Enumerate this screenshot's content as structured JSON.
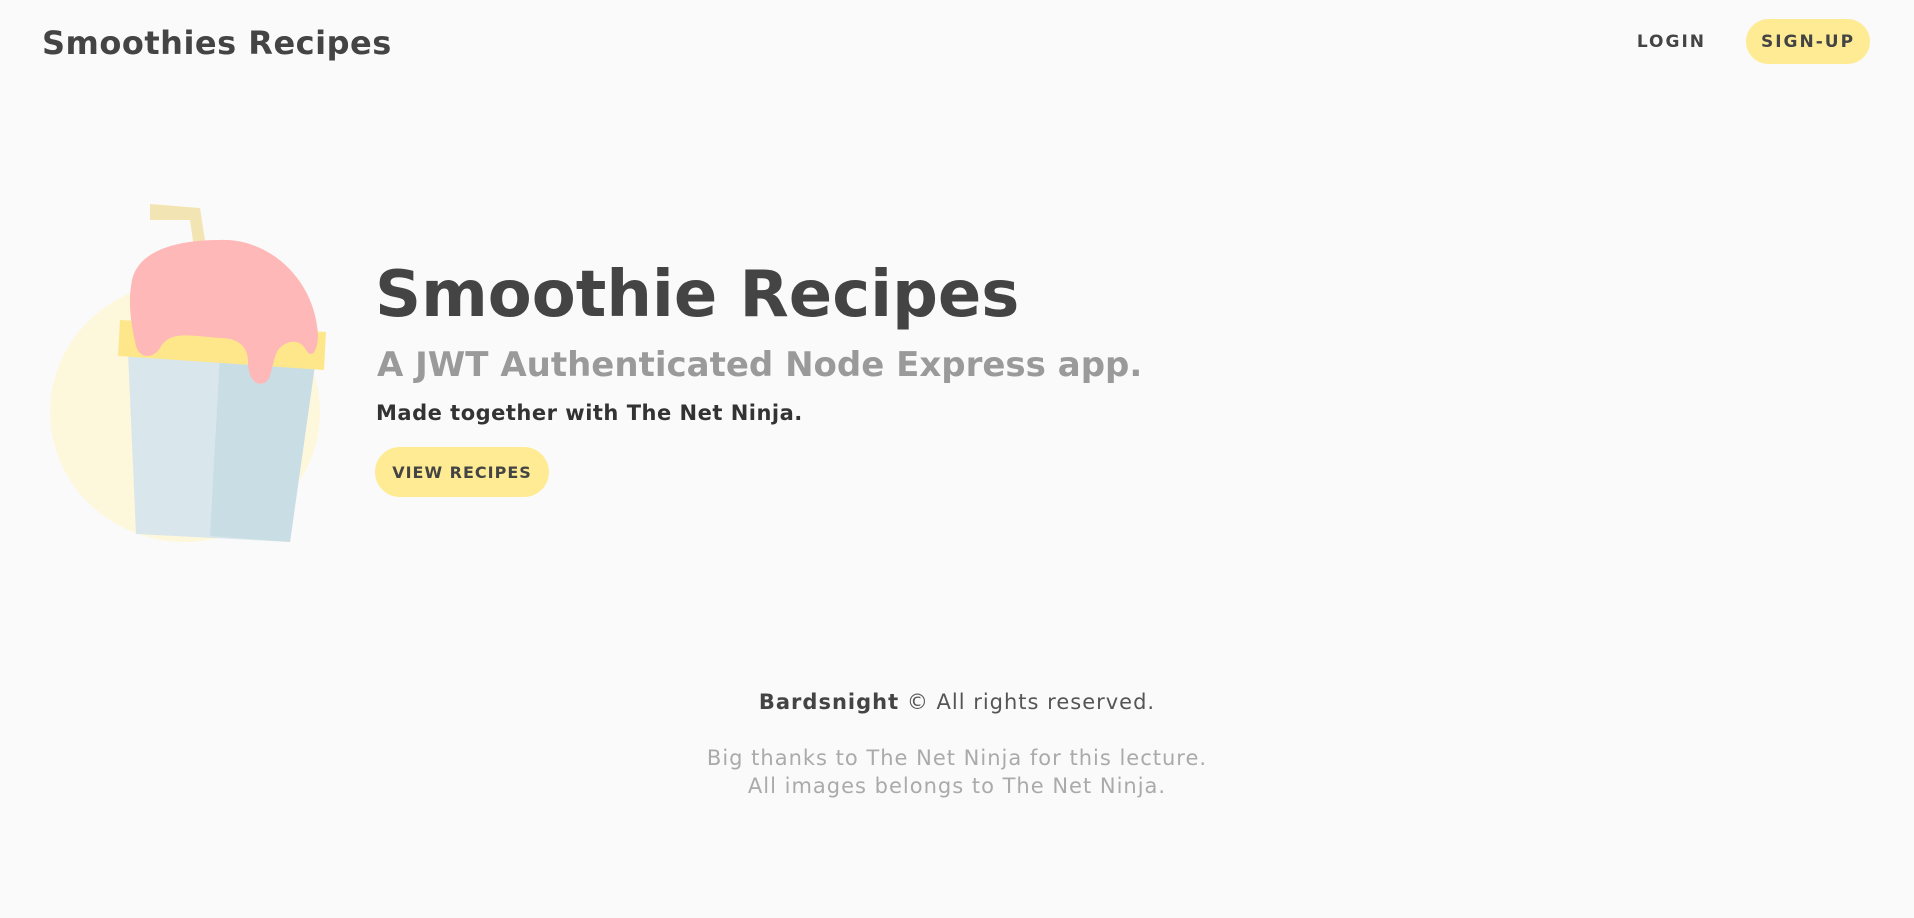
{
  "navbar": {
    "brand": "Smoothies Recipes",
    "login_label": "LOGIN",
    "signup_label": "SIGN-UP"
  },
  "hero": {
    "title": "Smoothie Recipes",
    "subtitle": "A JWT Authenticated Node Express app.",
    "tagline": "Made together with The Net Ninja.",
    "button_label": "VIEW RECIPES"
  },
  "footer": {
    "brand": "Bardsnight",
    "rights": "© All rights reserved.",
    "thanks_line1": "Big thanks to The Net Ninja for this lecture.",
    "thanks_line2": "All images belongs to The Net Ninja."
  },
  "colors": {
    "accent": "#feeb93",
    "background": "#fafafa",
    "text": "#444444",
    "muted": "#9a9a9a",
    "smoothie_pink": "#ffb8b8",
    "cup_blue": "#d5e6ec"
  }
}
